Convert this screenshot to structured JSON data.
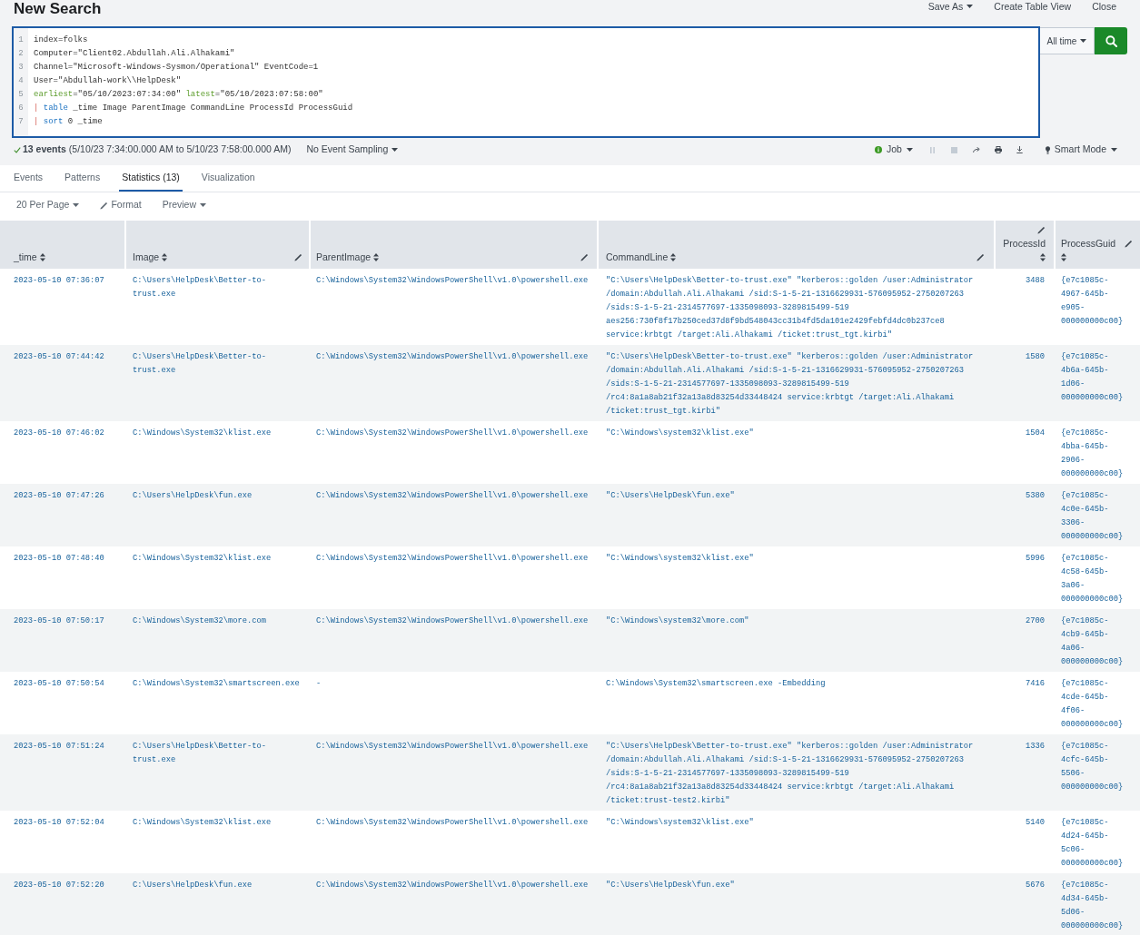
{
  "header": {
    "title": "New Search",
    "actions": [
      {
        "label": "Save As",
        "dropdown": true
      },
      {
        "label": "Create Table View",
        "dropdown": false
      },
      {
        "label": "Close",
        "dropdown": false
      }
    ]
  },
  "search": {
    "lines": [
      {
        "number": "1",
        "tokens": [
          {
            "kind": "text",
            "text": "index=folks"
          }
        ]
      },
      {
        "number": "2",
        "tokens": [
          {
            "kind": "text",
            "text": "Computer=\"Client02.Abdullah.Ali.Alhakami\""
          }
        ]
      },
      {
        "number": "3",
        "tokens": [
          {
            "kind": "text",
            "text": "Channel=\"Microsoft-Windows-Sysmon/Operational\" EventCode=1"
          }
        ]
      },
      {
        "number": "4",
        "tokens": [
          {
            "kind": "text",
            "text": "User=\"Abdullah-work\\\\HelpDesk\""
          }
        ]
      },
      {
        "number": "5",
        "tokens": [
          {
            "kind": "keyword",
            "text": "earliest"
          },
          {
            "kind": "text",
            "text": "=\"05/10/2023:07:34:00\" "
          },
          {
            "kind": "keyword",
            "text": "latest"
          },
          {
            "kind": "text",
            "text": "=\"05/10/2023:07:58:00\""
          }
        ]
      },
      {
        "number": "6",
        "tokens": [
          {
            "kind": "pipe",
            "text": "| "
          },
          {
            "kind": "command",
            "text": "table"
          },
          {
            "kind": "text",
            "text": " _time Image ParentImage CommandLine ProcessId ProcessGuid"
          }
        ]
      },
      {
        "number": "7",
        "tokens": [
          {
            "kind": "pipe",
            "text": "| "
          },
          {
            "kind": "command",
            "text": "sort"
          },
          {
            "kind": "text",
            "text": " 0 _time"
          }
        ]
      }
    ],
    "time_range": "All time"
  },
  "status": {
    "summary": "**13 events** (5/10/23 7:34:00.000 AM to 5/10/23 7:58:00.000 AM)",
    "sampling": "No Event Sampling",
    "job": "Job",
    "job_actions": [
      {
        "kind": "pause",
        "disabled": true
      },
      {
        "kind": "stop",
        "disabled": true
      },
      {
        "kind": "share",
        "disabled": false
      },
      {
        "kind": "print",
        "disabled": false
      },
      {
        "kind": "export",
        "disabled": false
      }
    ],
    "mode": "Smart Mode"
  },
  "tabs": [
    {
      "label": "Events",
      "selected": false
    },
    {
      "label": "Patterns",
      "selected": false
    },
    {
      "label": "Statistics (13)",
      "selected": true
    },
    {
      "label": "Visualization",
      "selected": false
    }
  ],
  "toolbar": [
    {
      "label": "20 Per Page",
      "kind": "menu"
    },
    {
      "label": "Format",
      "kind": "editor"
    },
    {
      "label": "Preview",
      "kind": "menu"
    }
  ],
  "table": {
    "columns": [
      {
        "label": "_time",
        "kind": "text",
        "sortable": true,
        "editable": false
      },
      {
        "label": "Image",
        "kind": "text",
        "sortable": true,
        "editable": true
      },
      {
        "label": "ParentImage",
        "kind": "text",
        "sortable": true,
        "editable": true
      },
      {
        "label": "CommandLine",
        "kind": "text",
        "sortable": true,
        "editable": true
      },
      {
        "label": "ProcessId",
        "kind": "number",
        "sortable": true,
        "editable": true
      },
      {
        "label": "ProcessGuid",
        "kind": "text",
        "sortable": true,
        "editable": true
      }
    ],
    "rows": [
      [
        "2023-05-10 07:36:07",
        "C:\\Users\\HelpDesk\\Better-to-trust.exe",
        "C:\\Windows\\System32\\WindowsPowerShell\\v1.0\\powershell.exe",
        "\"C:\\Users\\HelpDesk\\Better-to-trust.exe\" \"kerberos::golden /user:Administrator /domain:Abdullah.Ali.Alhakami /sid:S-1-5-21-1316629931-576095952-2750207263 /sids:S-1-5-21-2314577697-1335098093-3289815499-519 aes256:730f8f17b250ced37d8f9bd548043cc31b4fd5da101e2429febfd4dc0b237ce8 service:krbtgt /target:Ali.Alhakami /ticket:trust_tgt.kirbi\"",
        "3488",
        "{e7c1085c-4967-645b-e905-000000000c00}"
      ],
      [
        "2023-05-10 07:44:42",
        "C:\\Users\\HelpDesk\\Better-to-trust.exe",
        "C:\\Windows\\System32\\WindowsPowerShell\\v1.0\\powershell.exe",
        "\"C:\\Users\\HelpDesk\\Better-to-trust.exe\" \"kerberos::golden /user:Administrator /domain:Abdullah.Ali.Alhakami /sid:S-1-5-21-1316629931-576095952-2750207263 /sids:S-1-5-21-2314577697-1335098093-3289815499-519 /rc4:8a1a8ab21f32a13a8d83254d33448424 service:krbtgt /target:Ali.Alhakami /ticket:trust_tgt.kirbi\"",
        "1580",
        "{e7c1085c-4b6a-645b-1d06-000000000c00}"
      ],
      [
        "2023-05-10 07:46:02",
        "C:\\Windows\\System32\\klist.exe",
        "C:\\Windows\\System32\\WindowsPowerShell\\v1.0\\powershell.exe",
        "\"C:\\Windows\\system32\\klist.exe\"",
        "1504",
        "{e7c1085c-4bba-645b-2906-000000000c00}"
      ],
      [
        "2023-05-10 07:47:26",
        "C:\\Users\\HelpDesk\\fun.exe",
        "C:\\Windows\\System32\\WindowsPowerShell\\v1.0\\powershell.exe",
        "\"C:\\Users\\HelpDesk\\fun.exe\"",
        "5380",
        "{e7c1085c-4c0e-645b-3306-000000000c00}"
      ],
      [
        "2023-05-10 07:48:40",
        "C:\\Windows\\System32\\klist.exe",
        "C:\\Windows\\System32\\WindowsPowerShell\\v1.0\\powershell.exe",
        "\"C:\\Windows\\system32\\klist.exe\"",
        "5996",
        "{e7c1085c-4c58-645b-3a06-000000000c00}"
      ],
      [
        "2023-05-10 07:50:17",
        "C:\\Windows\\System32\\more.com",
        "C:\\Windows\\System32\\WindowsPowerShell\\v1.0\\powershell.exe",
        "\"C:\\Windows\\system32\\more.com\"",
        "2700",
        "{e7c1085c-4cb9-645b-4a06-000000000c00}"
      ],
      [
        "2023-05-10 07:50:54",
        "C:\\Windows\\System32\\smartscreen.exe",
        "-",
        "C:\\Windows\\System32\\smartscreen.exe -Embedding",
        "7416",
        "{e7c1085c-4cde-645b-4f06-000000000c00}"
      ],
      [
        "2023-05-10 07:51:24",
        "C:\\Users\\HelpDesk\\Better-to-trust.exe",
        "C:\\Windows\\System32\\WindowsPowerShell\\v1.0\\powershell.exe",
        "\"C:\\Users\\HelpDesk\\Better-to-trust.exe\" \"kerberos::golden /user:Administrator /domain:Abdullah.Ali.Alhakami /sid:S-1-5-21-1316629931-576095952-2750207263 /sids:S-1-5-21-2314577697-1335098093-3289815499-519 /rc4:8a1a8ab21f32a13a8d83254d33448424 service:krbtgt /target:Ali.Alhakami /ticket:trust-test2.kirbi\"",
        "1336",
        "{e7c1085c-4cfc-645b-5506-000000000c00}"
      ],
      [
        "2023-05-10 07:52:04",
        "C:\\Windows\\System32\\klist.exe",
        "C:\\Windows\\System32\\WindowsPowerShell\\v1.0\\powershell.exe",
        "\"C:\\Windows\\system32\\klist.exe\"",
        "5140",
        "{e7c1085c-4d24-645b-5c06-000000000c00}"
      ],
      [
        "2023-05-10 07:52:20",
        "C:\\Users\\HelpDesk\\fun.exe",
        "C:\\Windows\\System32\\WindowsPowerShell\\v1.0\\powershell.exe",
        "\"C:\\Users\\HelpDesk\\fun.exe\"",
        "5676",
        "{e7c1085c-4d34-645b-5d06-000000000c00}"
      ]
    ]
  }
}
